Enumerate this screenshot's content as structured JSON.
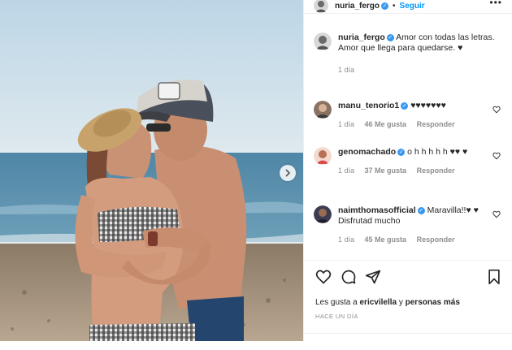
{
  "post": {
    "author": "nuria_fergo",
    "follow_label": "Seguir",
    "separator": "•",
    "more_label": "•••",
    "caption_author": "nuria_fergo",
    "caption_text": "Amor con todas las letras. Amor que llega para quedarse. ♥",
    "caption_time": "1 día"
  },
  "comments": [
    {
      "user": "manu_tenorio1",
      "text": "♥♥♥♥♥♥♥",
      "time": "1 día",
      "likes": "46 Me gusta",
      "reply": "Responder"
    },
    {
      "user": "genomachado",
      "text": "o h h h h h ♥♥ ♥",
      "time": "1 día",
      "likes": "37 Me gusta",
      "reply": "Responder"
    },
    {
      "user": "naimthomasofficial",
      "text": "Maravilla!!♥ ♥ Disfrutad mucho",
      "time": "1 día",
      "likes": "45 Me gusta",
      "reply": "Responder"
    }
  ],
  "likes_line": {
    "prefix": "Les gusta a ",
    "user": "ericvilella",
    "mid": " y ",
    "others": "personas más"
  },
  "date_label": "HACE UN DÍA",
  "colors": {
    "accent": "#0095f6",
    "verified": "#3897f0",
    "muted": "#8e8e8e"
  }
}
